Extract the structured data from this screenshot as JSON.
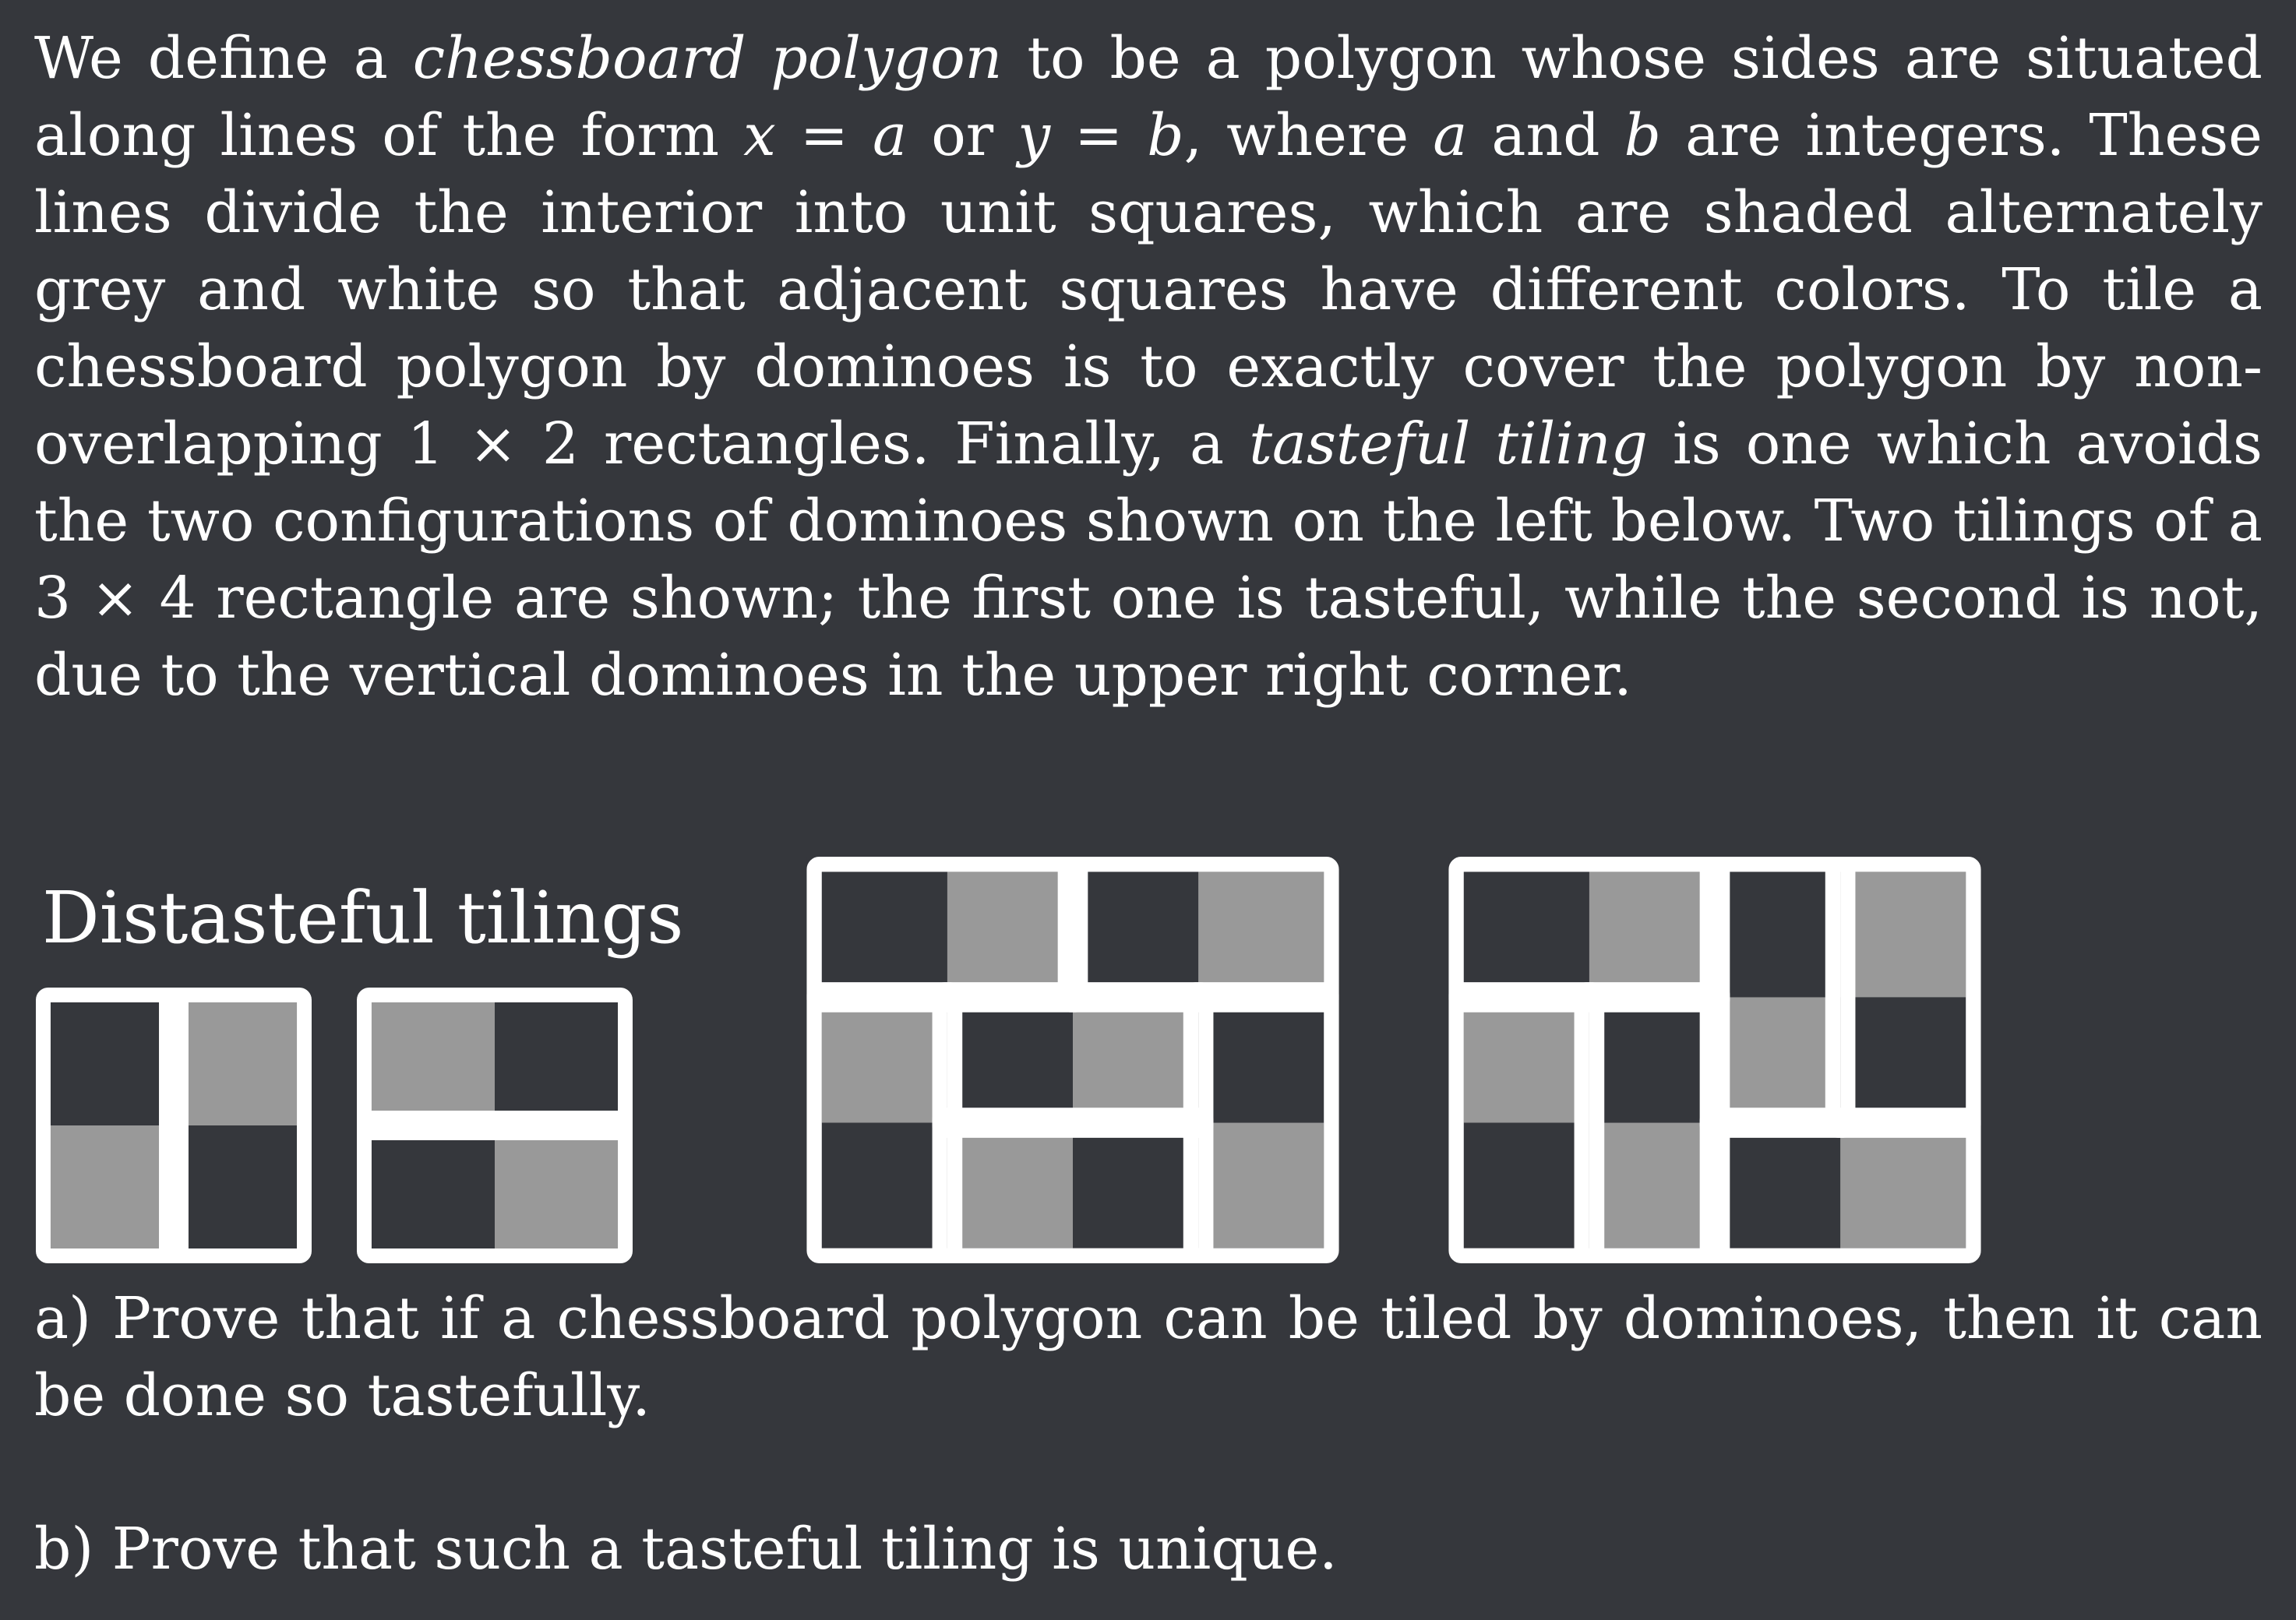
{
  "colors": {
    "background": "#35373c",
    "dark_square": "#35373c",
    "grey_square": "#999999",
    "domino_border": "#ffffff"
  },
  "problem": {
    "intro": [
      {
        "text": "We define a "
      },
      {
        "text": "chessboard polygon",
        "italic": true
      },
      {
        "text": " to be a polygon whose sides are situated along lines of the form "
      },
      {
        "text": "x",
        "italic": true
      },
      {
        "text": " = "
      },
      {
        "text": "a",
        "italic": true
      },
      {
        "text": " or "
      },
      {
        "text": "y",
        "italic": true
      },
      {
        "text": " = "
      },
      {
        "text": "b",
        "italic": true
      },
      {
        "text": ", where "
      },
      {
        "text": "a",
        "italic": true
      },
      {
        "text": " and "
      },
      {
        "text": "b",
        "italic": true
      },
      {
        "text": " are integers. These lines divide the interior into unit squares, which are shaded alternately grey and white so that adjacent squares have different colors.  To tile a chessboard polygon by dominoes is to exactly cover the polygon by non-overlapping 1 × 2 rectangles. Finally, a "
      },
      {
        "text": "tasteful tiling",
        "italic": true
      },
      {
        "text": " is one which avoids the two configurations of dominoes shown on the left below.  Two tilings of a 3 × 4 rectangle are shown; the first one is tasteful, while the second is not, due to the vertical dominoes in the upper right corner."
      }
    ],
    "heading": "Distasteful tilings",
    "part_a": "a) Prove that if a chessboard polygon can be tiled by dominoes, then it can be done so tastefully.",
    "part_b": "b) Prove that such a tasteful tiling is unique."
  },
  "figures": {
    "distasteful_1": {
      "rows": 2,
      "cols": 2,
      "shading": [
        [
          "dark",
          "grey"
        ],
        [
          "grey",
          "dark"
        ]
      ],
      "dominoes": [
        [
          [
            0,
            0
          ],
          [
            1,
            0
          ]
        ],
        [
          [
            0,
            1
          ],
          [
            1,
            1
          ]
        ]
      ]
    },
    "distasteful_2": {
      "rows": 2,
      "cols": 2,
      "shading": [
        [
          "grey",
          "dark"
        ],
        [
          "dark",
          "grey"
        ]
      ],
      "dominoes": [
        [
          [
            0,
            0
          ],
          [
            0,
            1
          ]
        ],
        [
          [
            1,
            0
          ],
          [
            1,
            1
          ]
        ]
      ]
    },
    "tasteful_3x4": {
      "rows": 3,
      "cols": 4,
      "shading": [
        [
          "dark",
          "grey",
          "dark",
          "grey"
        ],
        [
          "grey",
          "dark",
          "grey",
          "dark"
        ],
        [
          "dark",
          "grey",
          "dark",
          "grey"
        ]
      ],
      "dominoes": [
        [
          [
            0,
            0
          ],
          [
            0,
            1
          ]
        ],
        [
          [
            0,
            2
          ],
          [
            0,
            3
          ]
        ],
        [
          [
            1,
            0
          ],
          [
            2,
            0
          ]
        ],
        [
          [
            1,
            1
          ],
          [
            1,
            2
          ]
        ],
        [
          [
            1,
            3
          ],
          [
            2,
            3
          ]
        ],
        [
          [
            2,
            1
          ],
          [
            2,
            2
          ]
        ]
      ]
    },
    "distasteful_3x4": {
      "rows": 3,
      "cols": 4,
      "shading": [
        [
          "dark",
          "grey",
          "dark",
          "grey"
        ],
        [
          "grey",
          "dark",
          "grey",
          "dark"
        ],
        [
          "dark",
          "grey",
          "dark",
          "grey"
        ]
      ],
      "dominoes": [
        [
          [
            0,
            0
          ],
          [
            0,
            1
          ]
        ],
        [
          [
            0,
            2
          ],
          [
            1,
            2
          ]
        ],
        [
          [
            0,
            3
          ],
          [
            1,
            3
          ]
        ],
        [
          [
            1,
            0
          ],
          [
            2,
            0
          ]
        ],
        [
          [
            1,
            1
          ],
          [
            2,
            1
          ]
        ],
        [
          [
            2,
            2
          ],
          [
            2,
            3
          ]
        ]
      ]
    }
  }
}
